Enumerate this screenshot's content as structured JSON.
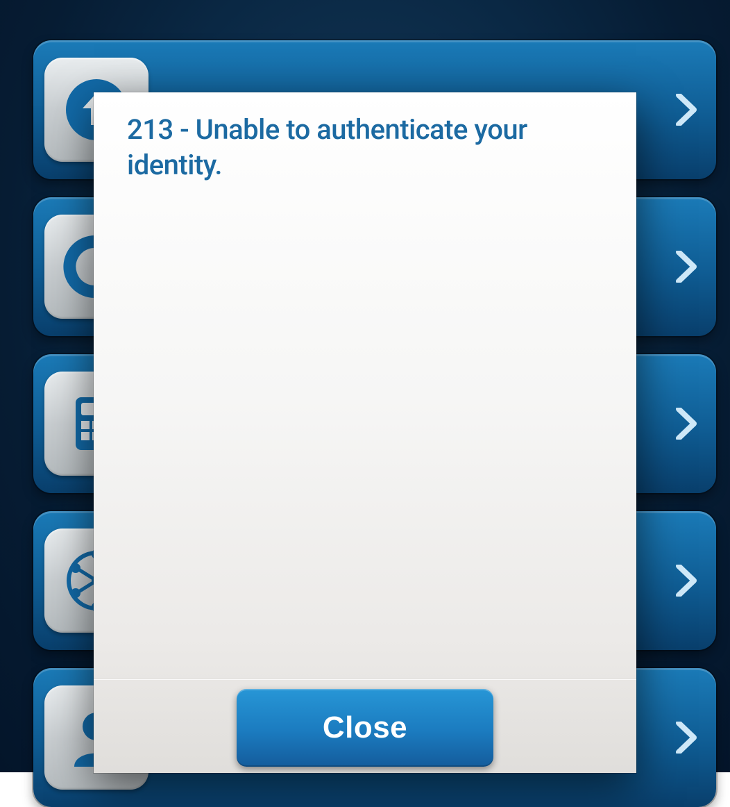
{
  "dialog": {
    "title": "213 - Unable to authenticate your identity.",
    "close_label": "Close"
  },
  "background_menu": {
    "items": [
      {
        "icon": "up-arrow-icon"
      },
      {
        "icon": "return-arrow-icon"
      },
      {
        "icon": "calculator-icon"
      },
      {
        "icon": "network-globe-icon"
      },
      {
        "icon": "person-icon"
      }
    ]
  },
  "colors": {
    "accent": "#1c6aa2",
    "button": "#1b7bbf"
  }
}
